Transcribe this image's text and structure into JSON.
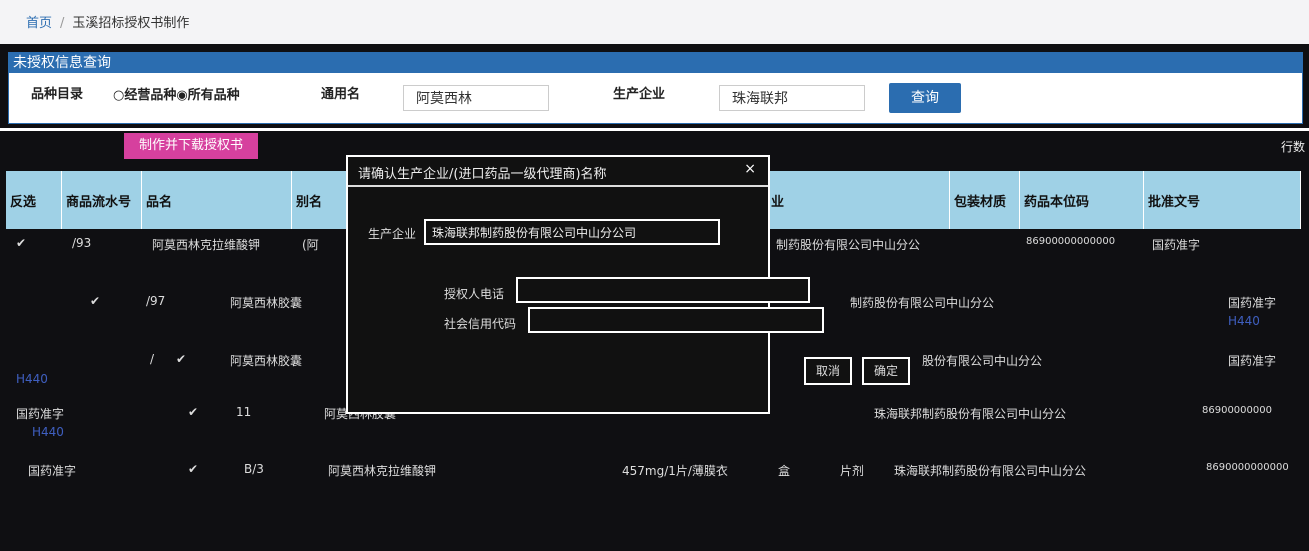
{
  "breadcrumb": {
    "home": "首页",
    "current": "玉溪招标授权书制作"
  },
  "panel": {
    "title": "未授权信息查询",
    "category_label": "品种目录",
    "category_radio": "○经营品种◉所有品种",
    "generic_label": "通用名",
    "generic_value": "阿莫西林",
    "maker_label": "生产企业",
    "maker_value": "珠海联邦",
    "query_button": "查询"
  },
  "toolbar": {
    "make_button": "制作并下载授权书",
    "right_text": "行数"
  },
  "table": {
    "headers": {
      "invert": "反选",
      "serial": "商品流水号",
      "name": "品名",
      "alias": "别名",
      "company": "业",
      "package": "包装材质",
      "code": "药品本位码",
      "approval": "批准文号"
    },
    "rows": [
      {
        "check": "✔",
        "serial": "/93",
        "name": "阿莫西林克拉维酸钾",
        "alias": "(阿",
        "company": "制药股份有限公司中山分公",
        "code": "86900000000000",
        "approval": "国药准字"
      },
      {
        "check": "✔",
        "serial": "/97",
        "name": "阿莫西林胶囊",
        "company": "制药股份有限公司中山分公",
        "approval": "国药准字",
        "approval_no": "H440"
      },
      {
        "check": "✔",
        "serial": "/",
        "name": "阿莫西林胶囊",
        "company": "股份有限公司中山分公",
        "approval": "国药准字",
        "approval_no": "H440"
      },
      {
        "check": "✔",
        "serial": "11",
        "name": "阿莫西林胶囊",
        "company": "珠海联邦制药股份有限公司中山分公",
        "approval": "国药准字",
        "approval_no": "H440",
        "code": "86900000000"
      },
      {
        "check": "✔",
        "serial": "B/3",
        "name": "阿莫西林克拉维酸钾",
        "spec": "457mg/1片/薄膜衣",
        "package": "盒",
        "form": "片剂",
        "company": "珠海联邦制药股份有限公司中山分公",
        "approval": "国药准字",
        "code": "8690000000000"
      }
    ]
  },
  "dialog": {
    "title": "请确认生产企业/(进口药品一级代理商)名称",
    "close": "×",
    "company_label": "生产企业",
    "company_value": "珠海联邦制药股份有限公司中山分公司",
    "phone_label": "授权人电话",
    "credit_label": "社会信用代码",
    "cancel_button": "取消",
    "confirm_button": "确定"
  }
}
